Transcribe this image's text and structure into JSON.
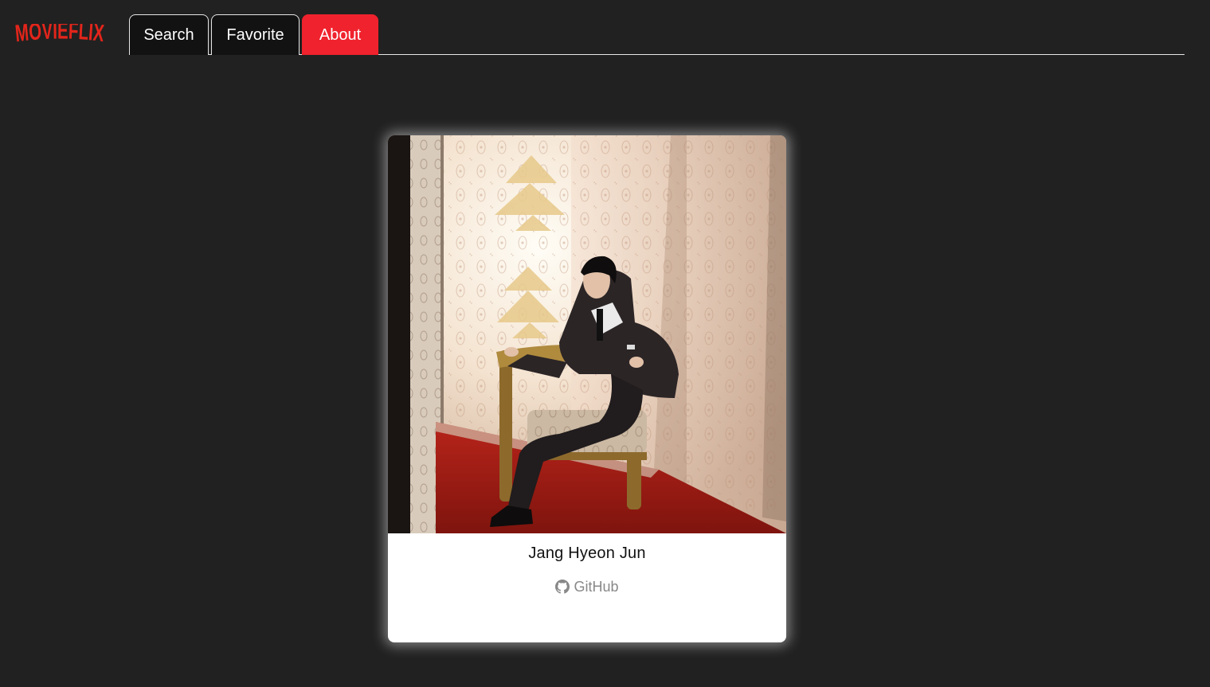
{
  "app": {
    "logo_text": "MOVIEFLIX"
  },
  "nav": {
    "tabs": [
      {
        "label": "Search",
        "active": false
      },
      {
        "label": "Favorite",
        "active": false
      },
      {
        "label": "About",
        "active": true
      }
    ]
  },
  "profile": {
    "name": "Jang Hyeon Jun",
    "github_label": "GitHub",
    "github_icon": "github-icon"
  },
  "colors": {
    "background": "#212121",
    "accent": "#f0222d",
    "logo": "#e3251b",
    "card": "#ffffff"
  }
}
